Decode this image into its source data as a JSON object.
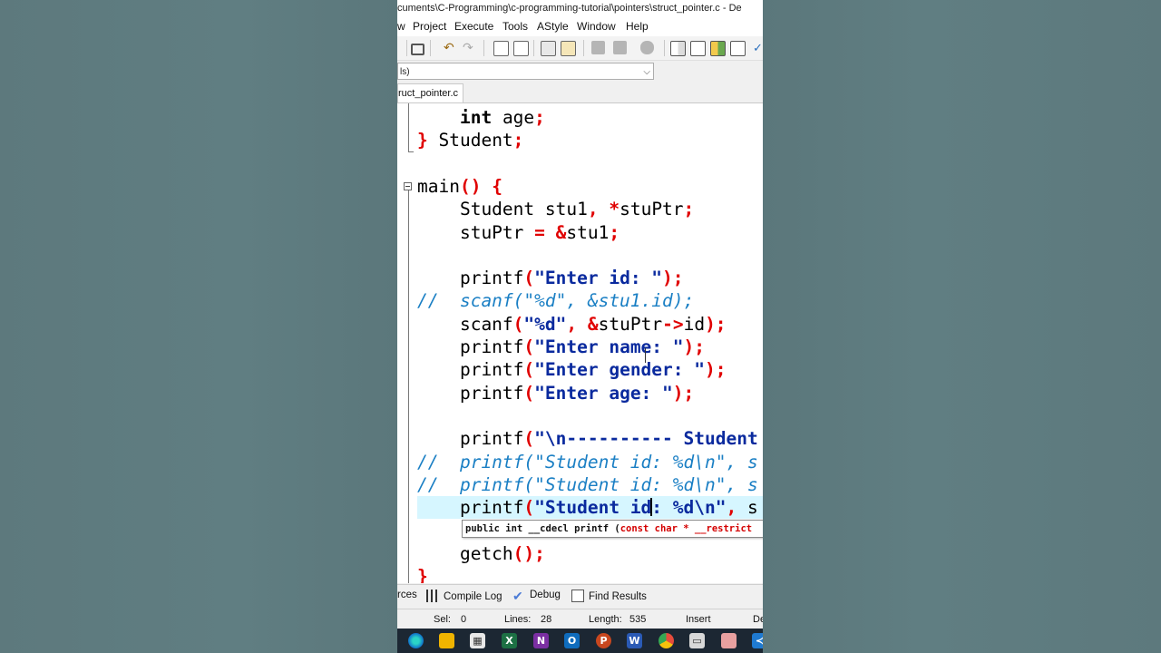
{
  "window": {
    "title": "cuments\\C-Programming\\c-programming-tutorial\\pointers\\struct_pointer.c - De"
  },
  "menu": [
    "w",
    "Project",
    "Execute",
    "Tools",
    "AStyle",
    "Window",
    "Help"
  ],
  "class_combo": {
    "value": "ls)"
  },
  "tab": {
    "label": "ruct_pointer.c"
  },
  "code_lines": [
    [
      [
        "",
        "    "
      ],
      [
        "kw",
        "int"
      ],
      [
        "",
        " age"
      ],
      [
        "sym",
        ";"
      ]
    ],
    [
      [
        "sym",
        "}"
      ],
      [
        "",
        " Student"
      ],
      [
        "sym",
        ";"
      ]
    ],
    [],
    [
      [
        "",
        "main"
      ],
      [
        "sym",
        "()"
      ],
      [
        "",
        " "
      ],
      [
        "sym",
        "{"
      ]
    ],
    [
      [
        "",
        "    Student stu1"
      ],
      [
        "sym",
        ","
      ],
      [
        "",
        " "
      ],
      [
        "sym",
        "*"
      ],
      [
        "",
        "stuPtr"
      ],
      [
        "sym",
        ";"
      ]
    ],
    [
      [
        "",
        "    stuPtr "
      ],
      [
        "sym",
        "="
      ],
      [
        "",
        " "
      ],
      [
        "sym",
        "&"
      ],
      [
        "",
        "stu1"
      ],
      [
        "sym",
        ";"
      ]
    ],
    [],
    [
      [
        "",
        "    printf"
      ],
      [
        "sym",
        "("
      ],
      [
        "str",
        "\"Enter id: \""
      ],
      [
        "sym",
        ");"
      ]
    ],
    [
      [
        "cmt",
        "//  scanf(\"%d\", &stu1.id);"
      ]
    ],
    [
      [
        "",
        "    scanf"
      ],
      [
        "sym",
        "("
      ],
      [
        "str",
        "\"%d\""
      ],
      [
        "sym",
        ","
      ],
      [
        "",
        " "
      ],
      [
        "sym",
        "&"
      ],
      [
        "",
        "stuPtr"
      ],
      [
        "sym",
        "->"
      ],
      [
        "",
        "id"
      ],
      [
        "sym",
        ");"
      ]
    ],
    [
      [
        "",
        "    printf"
      ],
      [
        "sym",
        "("
      ],
      [
        "str",
        "\"Enter name: \""
      ],
      [
        "sym",
        ");"
      ]
    ],
    [
      [
        "",
        "    printf"
      ],
      [
        "sym",
        "("
      ],
      [
        "str",
        "\"Enter gender: \""
      ],
      [
        "sym",
        ");"
      ]
    ],
    [
      [
        "",
        "    printf"
      ],
      [
        "sym",
        "("
      ],
      [
        "str",
        "\"Enter age: \""
      ],
      [
        "sym",
        ");"
      ]
    ],
    [],
    [
      [
        "",
        "    printf"
      ],
      [
        "sym",
        "("
      ],
      [
        "str",
        "\"\\n---------- Student"
      ]
    ],
    [
      [
        "cmt",
        "//  printf(\"Student id: %d\\n\", s"
      ]
    ],
    [
      [
        "cmt",
        "//  printf(\"Student id: %d\\n\", s"
      ]
    ],
    [
      [
        "",
        "    printf"
      ],
      [
        "sym",
        "("
      ],
      [
        "str",
        "\"Student id"
      ],
      [
        "caret",
        ""
      ],
      [
        "str",
        ": %d\\n\""
      ],
      [
        "sym",
        ","
      ],
      [
        "",
        " s"
      ]
    ],
    [],
    [
      [
        "",
        "    getch"
      ],
      [
        "sym",
        "();"
      ]
    ],
    [
      [
        "sym",
        "}"
      ]
    ]
  ],
  "tooltip": {
    "prefix": "public int __cdecl printf (",
    "suffix": "const char * __restrict"
  },
  "bottom_tabs": [
    "rces",
    "Compile Log",
    "Debug",
    "Find Results"
  ],
  "status": {
    "sel_label": "Sel:",
    "sel": "0",
    "lines_label": "Lines:",
    "lines": "28",
    "length_label": "Length:",
    "length": "535",
    "mode": "Insert",
    "extra": "De"
  },
  "taskbar_icons": [
    "windows-icon",
    "edge-icon",
    "file-explorer-icon",
    "store-icon",
    "excel-icon",
    "onenote-icon",
    "outlook-icon",
    "powerpoint-icon",
    "word-icon",
    "chrome-icon",
    "computer-icon",
    "paint-icon",
    "vscode-icon"
  ]
}
